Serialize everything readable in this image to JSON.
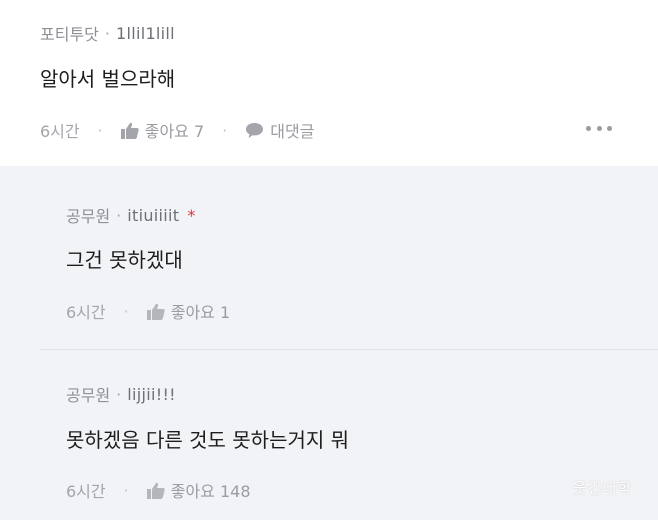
{
  "comment": {
    "author": "포티투닷",
    "userid": "1llil1lill",
    "text": "알아서 벌으라해",
    "time": "6시간",
    "like_label": "좋아요 7",
    "reply_label": "대댓글"
  },
  "replies": [
    {
      "author": "공무원",
      "userid": "itiuiiiit",
      "star": "*",
      "text": "그건 못하겠대",
      "time": "6시간",
      "like_label": "좋아요 1"
    },
    {
      "author": "공무원",
      "userid": "lijjii!!!",
      "text": "못하겠음 다른 것도 못하는거지 뭐",
      "time": "6시간",
      "like_label": "좋아요 148"
    }
  ],
  "separator": "·",
  "watermark": "웃긴대학",
  "icons": {
    "like": "thumbs-up-icon",
    "reply": "speech-bubble-icon",
    "more": "more-dots-icon"
  },
  "colors": {
    "reply_background": "#f2f3f6",
    "star": "#e0313b"
  }
}
